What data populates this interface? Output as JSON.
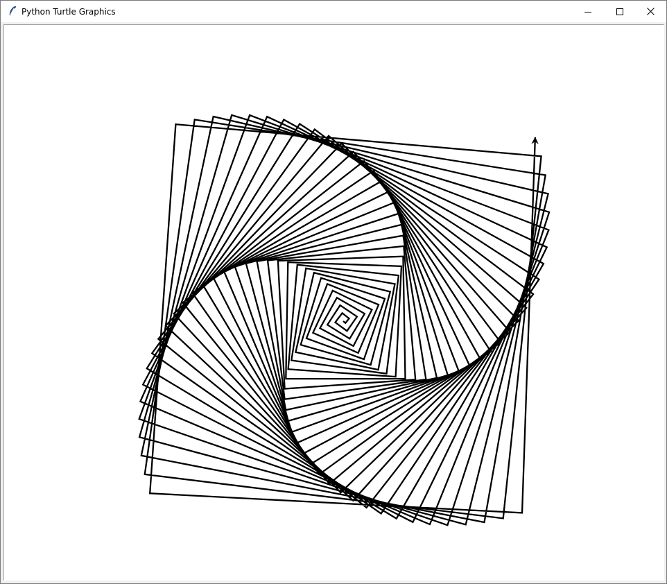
{
  "window": {
    "title": "Python Turtle Graphics",
    "app_icon": "feather-icon",
    "controls": {
      "minimize_icon": "minimize-icon",
      "maximize_icon": "maximize-icon",
      "close_icon": "close-icon"
    }
  },
  "canvas": {
    "background": "#ffffff",
    "pen_color": "#000000",
    "drawing": "square spiral",
    "turtle_icon": "turtle-arrow-icon"
  }
}
